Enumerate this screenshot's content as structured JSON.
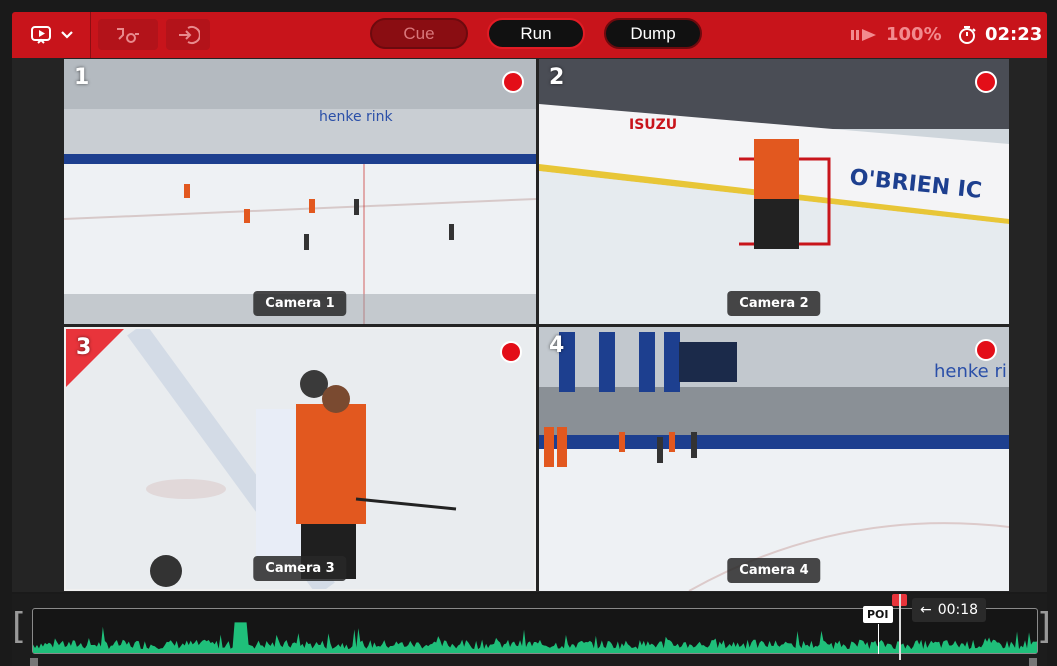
{
  "colors": {
    "accent": "#c8141b",
    "record": "#e30e18",
    "waveform": "#1fbf7a"
  },
  "toolbar": {
    "cue_label": "Cue",
    "run_label": "Run",
    "dump_label": "Dump",
    "speed_label": "100%",
    "timer_label": "02:23",
    "icons": [
      "replay-icon",
      "chevron-down-icon",
      "camera-switch-icon",
      "export-icon",
      "play-speed-icon",
      "stopwatch-icon"
    ]
  },
  "cameras": [
    {
      "number": "1",
      "label": "Camera 1",
      "recording": true,
      "selected": false
    },
    {
      "number": "2",
      "label": "Camera 2",
      "recording": true,
      "selected": false
    },
    {
      "number": "3",
      "label": "Camera 3",
      "recording": true,
      "selected": true
    },
    {
      "number": "4",
      "label": "Camera 4",
      "recording": true,
      "selected": false
    }
  ],
  "timeline": {
    "poi_label": "POI",
    "offset_label": "00:18",
    "arrow": "←"
  }
}
